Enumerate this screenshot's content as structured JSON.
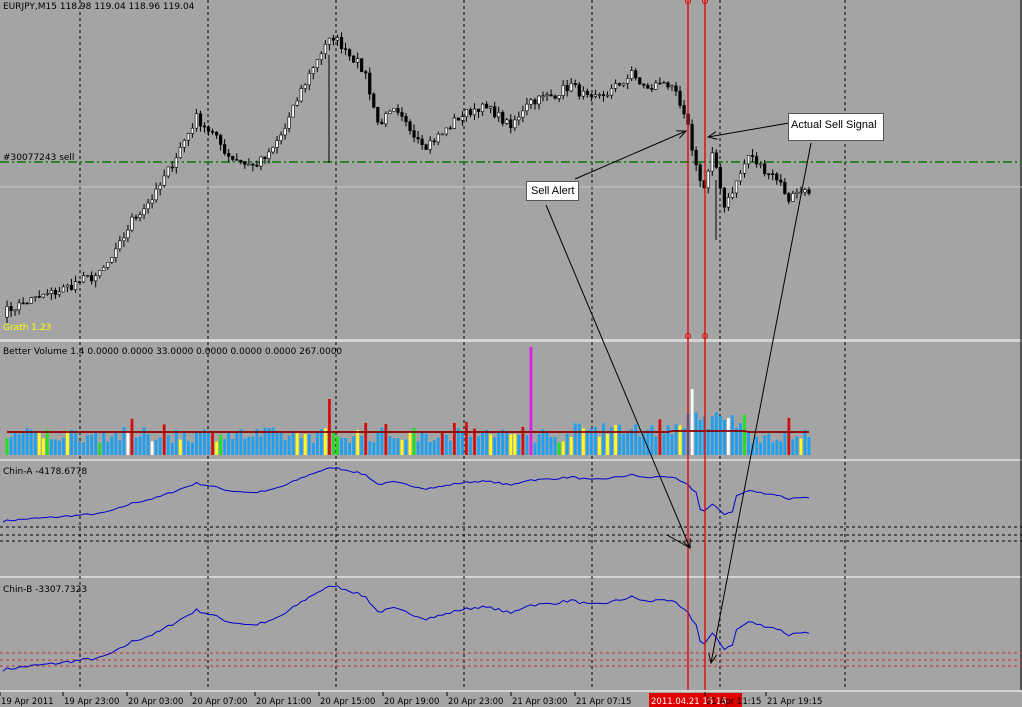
{
  "app": {
    "symbol_info": "EURJPY,M15  118.98 119.04 118.96 119.04"
  },
  "price_panel": {
    "order_label": "#30077243 sell",
    "grath_label": "Grath 1.23",
    "order_level": 119.5,
    "last_price": 119.04,
    "ylim": [
      116.5,
      122.6
    ]
  },
  "indicators": {
    "volume": {
      "label": "Better Volume 1.4 0.0000 0.0000 33.0000 0.0000 0.0000 0.0000 267.0000"
    },
    "chin_a": {
      "label": "Chin-A -4178.6778"
    },
    "chin_b": {
      "label": "Chin-B -3307.7323"
    }
  },
  "annotations": {
    "sell_alert": "Sell Alert",
    "actual_sell_signal": "Actual Sell Signal"
  },
  "x_axis": {
    "ticks": [
      "19 Apr 2011",
      "19 Apr 23:00",
      "20 Apr 03:00",
      "20 Apr 07:00",
      "20 Apr 11:00",
      "20 Apr 15:00",
      "20 Apr 19:00",
      "20 Apr 23:00",
      "21 Apr 03:00",
      "21 Apr 07:15",
      "21 Apr 11:15",
      "21 Apr 19:15"
    ],
    "highlight": "2011.04.21 15:15"
  },
  "colors": {
    "background": "#a4a4a4",
    "candle": "#000000",
    "grid": "#000000",
    "order_line": "#0a7a0a",
    "signal_line": "#e00000",
    "volume_blue": "#1ea0f0",
    "volume_red": "#d01010",
    "volume_green": "#20e020",
    "volume_yellow": "#ffff20",
    "volume_white": "#ffffff",
    "volume_magenta": "#e020e0",
    "volume_ma": "#8b0000",
    "indicator_line": "#0000cc",
    "axis_highlight": "#e00000",
    "label_yellow": "#ffff00"
  },
  "chart_data": [
    {
      "type": "candlestick",
      "title": "EURJPY,M15",
      "x_range": [
        "19 Apr 2011",
        "21 Apr 19:15"
      ],
      "close_anchors": [
        [
          0,
          116.9
        ],
        [
          6,
          117.1
        ],
        [
          14,
          117.3
        ],
        [
          20,
          117.5
        ],
        [
          24,
          117.6
        ],
        [
          28,
          118.0
        ],
        [
          32,
          118.6
        ],
        [
          38,
          119.1
        ],
        [
          43,
          119.8
        ],
        [
          48,
          120.5
        ],
        [
          52,
          120.2
        ],
        [
          56,
          119.8
        ],
        [
          62,
          119.6
        ],
        [
          66,
          119.8
        ],
        [
          70,
          120.3
        ],
        [
          74,
          121.0
        ],
        [
          78,
          121.6
        ],
        [
          82,
          122.0
        ],
        [
          86,
          121.7
        ],
        [
          90,
          121.3
        ],
        [
          93,
          120.4
        ],
        [
          97,
          120.6
        ],
        [
          101,
          120.3
        ],
        [
          105,
          120.0
        ],
        [
          109,
          120.2
        ],
        [
          113,
          120.5
        ],
        [
          118,
          120.7
        ],
        [
          122,
          120.6
        ],
        [
          126,
          120.3
        ],
        [
          130,
          120.8
        ],
        [
          136,
          120.9
        ],
        [
          141,
          121.1
        ],
        [
          146,
          120.8
        ],
        [
          151,
          121.0
        ],
        [
          156,
          121.3
        ],
        [
          160,
          121.0
        ],
        [
          164,
          121.2
        ],
        [
          167,
          120.9
        ],
        [
          170,
          120.3
        ],
        [
          172,
          119.6
        ],
        [
          174,
          119.2
        ],
        [
          176,
          119.8
        ],
        [
          179,
          118.9
        ],
        [
          182,
          119.3
        ],
        [
          185,
          119.8
        ],
        [
          188,
          119.6
        ],
        [
          192,
          119.4
        ],
        [
          195,
          119.0
        ],
        [
          198,
          119.2
        ],
        [
          200,
          119.04
        ]
      ]
    },
    {
      "type": "bar",
      "title": "Better Volume 1.4",
      "values": [
        33,
        267
      ],
      "note": "tick volume histogram with moving average"
    },
    {
      "type": "line",
      "title": "Chin-A",
      "last_value": -4178.6778
    },
    {
      "type": "line",
      "title": "Chin-B",
      "last_value": -3307.7323
    }
  ]
}
